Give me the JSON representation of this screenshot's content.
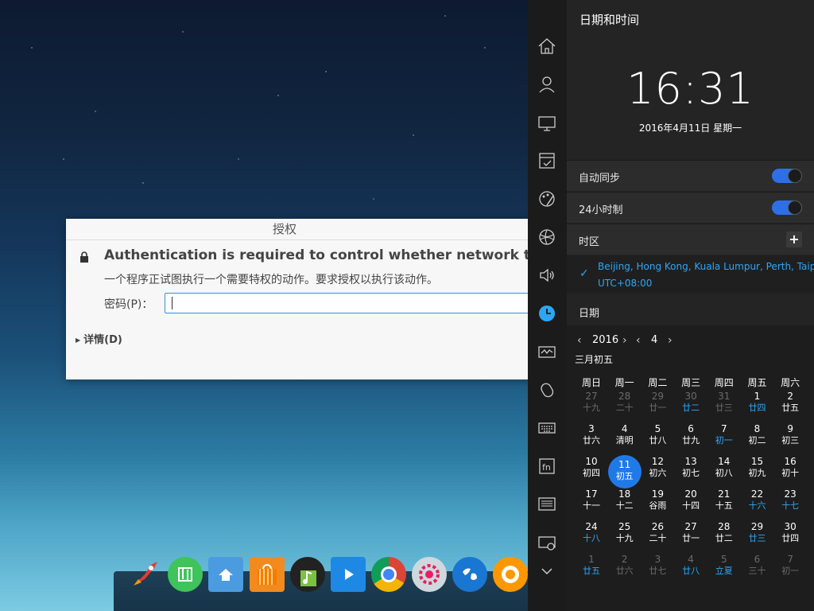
{
  "dialog": {
    "title": "授权",
    "heading": "Authentication is required to control whether network time sync",
    "subtitle": "一个程序正试图执行一个需要特权的动作。要求授权以执行该动作。",
    "password_label": "密码(P)：",
    "password_value": "",
    "details_label": "详情(D)"
  },
  "dock": {
    "icons": [
      "rocket-launcher-icon",
      "deepin-store-icon",
      "file-manager-icon",
      "app-store-bag-icon",
      "music-player-icon",
      "video-player-icon",
      "chrome-browser-icon",
      "settings-gear-icon",
      "globe-browser-icon",
      "screen-recorder-icon"
    ]
  },
  "sidebar": {
    "icons": [
      "home-icon",
      "user-icon",
      "display-icon",
      "default-apps-icon",
      "personalization-icon",
      "network-icon",
      "sound-icon",
      "datetime-icon",
      "power-icon",
      "mouse-icon",
      "keyboard-icon",
      "fn-key-icon",
      "update-icon",
      "system-info-icon",
      "more-chevron-icon"
    ],
    "active": "datetime-icon",
    "accent": "#2ca7f8"
  },
  "panel": {
    "title": "日期和时间",
    "clock": "16:31",
    "date": "2016年4月11日 星期一",
    "auto_sync": {
      "label": "自动同步",
      "enabled": true
    },
    "hour24": {
      "label": "24小时制",
      "enabled": true
    },
    "timezone": {
      "label": "时区",
      "add": "+",
      "check": "✓",
      "name": "Beijing, Hong Kong, Kuala Lumpur, Perth, Taipe",
      "offset": "UTC+08:00"
    },
    "date_label": "日期",
    "calendar": {
      "year": "2016",
      "month": "4",
      "prev": "‹",
      "next": "›",
      "lunar_month": "三月初五",
      "weekdays": [
        "周日",
        "周一",
        "周二",
        "周三",
        "周四",
        "周五",
        "周六"
      ],
      "rows": [
        [
          {
            "d": "27",
            "l": "十九",
            "o": true
          },
          {
            "d": "28",
            "l": "二十",
            "o": true
          },
          {
            "d": "29",
            "l": "廿一",
            "o": true
          },
          {
            "d": "30",
            "l": "廿二",
            "o": true,
            "h": true
          },
          {
            "d": "31",
            "l": "廿三",
            "o": true
          },
          {
            "d": "1",
            "l": "廿四",
            "h": true
          },
          {
            "d": "2",
            "l": "廿五"
          }
        ],
        [
          {
            "d": "3",
            "l": "廿六"
          },
          {
            "d": "4",
            "l": "清明"
          },
          {
            "d": "5",
            "l": "廿八"
          },
          {
            "d": "6",
            "l": "廿九"
          },
          {
            "d": "7",
            "l": "初一",
            "h": true
          },
          {
            "d": "8",
            "l": "初二"
          },
          {
            "d": "9",
            "l": "初三"
          }
        ],
        [
          {
            "d": "10",
            "l": "初四"
          },
          {
            "d": "11",
            "l": "初五",
            "s": true
          },
          {
            "d": "12",
            "l": "初六"
          },
          {
            "d": "13",
            "l": "初七"
          },
          {
            "d": "14",
            "l": "初八"
          },
          {
            "d": "15",
            "l": "初九"
          },
          {
            "d": "16",
            "l": "初十"
          }
        ],
        [
          {
            "d": "17",
            "l": "十一"
          },
          {
            "d": "18",
            "l": "十二"
          },
          {
            "d": "19",
            "l": "谷雨"
          },
          {
            "d": "20",
            "l": "十四"
          },
          {
            "d": "21",
            "l": "十五"
          },
          {
            "d": "22",
            "l": "十六",
            "h": true
          },
          {
            "d": "23",
            "l": "十七",
            "h": true
          }
        ],
        [
          {
            "d": "24",
            "l": "十八",
            "h": true
          },
          {
            "d": "25",
            "l": "十九"
          },
          {
            "d": "26",
            "l": "二十"
          },
          {
            "d": "27",
            "l": "廿一"
          },
          {
            "d": "28",
            "l": "廿二"
          },
          {
            "d": "29",
            "l": "廿三",
            "h": true
          },
          {
            "d": "30",
            "l": "廿四"
          }
        ],
        [
          {
            "d": "1",
            "l": "廿五",
            "o": true,
            "h": true
          },
          {
            "d": "2",
            "l": "廿六",
            "o": true
          },
          {
            "d": "3",
            "l": "廿七",
            "o": true
          },
          {
            "d": "4",
            "l": "廿八",
            "o": true,
            "h": true
          },
          {
            "d": "5",
            "l": "立夏",
            "o": true,
            "h": true
          },
          {
            "d": "6",
            "l": "三十",
            "o": true
          },
          {
            "d": "7",
            "l": "初一",
            "o": true
          }
        ]
      ]
    }
  }
}
